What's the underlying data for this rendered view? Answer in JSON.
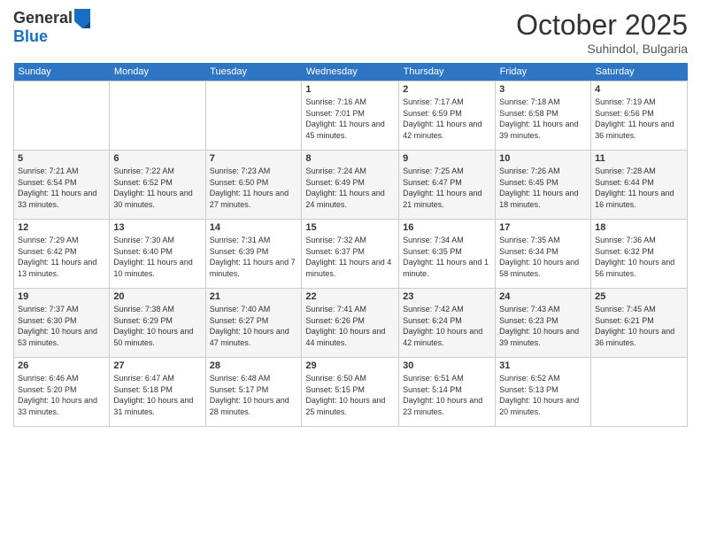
{
  "header": {
    "logo_general": "General",
    "logo_blue": "Blue",
    "month_title": "October 2025",
    "location": "Suhindol, Bulgaria"
  },
  "days_of_week": [
    "Sunday",
    "Monday",
    "Tuesday",
    "Wednesday",
    "Thursday",
    "Friday",
    "Saturday"
  ],
  "weeks": [
    [
      {
        "day": "",
        "sunrise": "",
        "sunset": "",
        "daylight": ""
      },
      {
        "day": "",
        "sunrise": "",
        "sunset": "",
        "daylight": ""
      },
      {
        "day": "",
        "sunrise": "",
        "sunset": "",
        "daylight": ""
      },
      {
        "day": "1",
        "sunrise": "Sunrise: 7:16 AM",
        "sunset": "Sunset: 7:01 PM",
        "daylight": "Daylight: 11 hours and 45 minutes."
      },
      {
        "day": "2",
        "sunrise": "Sunrise: 7:17 AM",
        "sunset": "Sunset: 6:59 PM",
        "daylight": "Daylight: 11 hours and 42 minutes."
      },
      {
        "day": "3",
        "sunrise": "Sunrise: 7:18 AM",
        "sunset": "Sunset: 6:58 PM",
        "daylight": "Daylight: 11 hours and 39 minutes."
      },
      {
        "day": "4",
        "sunrise": "Sunrise: 7:19 AM",
        "sunset": "Sunset: 6:56 PM",
        "daylight": "Daylight: 11 hours and 36 minutes."
      }
    ],
    [
      {
        "day": "5",
        "sunrise": "Sunrise: 7:21 AM",
        "sunset": "Sunset: 6:54 PM",
        "daylight": "Daylight: 11 hours and 33 minutes."
      },
      {
        "day": "6",
        "sunrise": "Sunrise: 7:22 AM",
        "sunset": "Sunset: 6:52 PM",
        "daylight": "Daylight: 11 hours and 30 minutes."
      },
      {
        "day": "7",
        "sunrise": "Sunrise: 7:23 AM",
        "sunset": "Sunset: 6:50 PM",
        "daylight": "Daylight: 11 hours and 27 minutes."
      },
      {
        "day": "8",
        "sunrise": "Sunrise: 7:24 AM",
        "sunset": "Sunset: 6:49 PM",
        "daylight": "Daylight: 11 hours and 24 minutes."
      },
      {
        "day": "9",
        "sunrise": "Sunrise: 7:25 AM",
        "sunset": "Sunset: 6:47 PM",
        "daylight": "Daylight: 11 hours and 21 minutes."
      },
      {
        "day": "10",
        "sunrise": "Sunrise: 7:26 AM",
        "sunset": "Sunset: 6:45 PM",
        "daylight": "Daylight: 11 hours and 18 minutes."
      },
      {
        "day": "11",
        "sunrise": "Sunrise: 7:28 AM",
        "sunset": "Sunset: 6:44 PM",
        "daylight": "Daylight: 11 hours and 16 minutes."
      }
    ],
    [
      {
        "day": "12",
        "sunrise": "Sunrise: 7:29 AM",
        "sunset": "Sunset: 6:42 PM",
        "daylight": "Daylight: 11 hours and 13 minutes."
      },
      {
        "day": "13",
        "sunrise": "Sunrise: 7:30 AM",
        "sunset": "Sunset: 6:40 PM",
        "daylight": "Daylight: 11 hours and 10 minutes."
      },
      {
        "day": "14",
        "sunrise": "Sunrise: 7:31 AM",
        "sunset": "Sunset: 6:39 PM",
        "daylight": "Daylight: 11 hours and 7 minutes."
      },
      {
        "day": "15",
        "sunrise": "Sunrise: 7:32 AM",
        "sunset": "Sunset: 6:37 PM",
        "daylight": "Daylight: 11 hours and 4 minutes."
      },
      {
        "day": "16",
        "sunrise": "Sunrise: 7:34 AM",
        "sunset": "Sunset: 6:35 PM",
        "daylight": "Daylight: 11 hours and 1 minute."
      },
      {
        "day": "17",
        "sunrise": "Sunrise: 7:35 AM",
        "sunset": "Sunset: 6:34 PM",
        "daylight": "Daylight: 10 hours and 58 minutes."
      },
      {
        "day": "18",
        "sunrise": "Sunrise: 7:36 AM",
        "sunset": "Sunset: 6:32 PM",
        "daylight": "Daylight: 10 hours and 56 minutes."
      }
    ],
    [
      {
        "day": "19",
        "sunrise": "Sunrise: 7:37 AM",
        "sunset": "Sunset: 6:30 PM",
        "daylight": "Daylight: 10 hours and 53 minutes."
      },
      {
        "day": "20",
        "sunrise": "Sunrise: 7:38 AM",
        "sunset": "Sunset: 6:29 PM",
        "daylight": "Daylight: 10 hours and 50 minutes."
      },
      {
        "day": "21",
        "sunrise": "Sunrise: 7:40 AM",
        "sunset": "Sunset: 6:27 PM",
        "daylight": "Daylight: 10 hours and 47 minutes."
      },
      {
        "day": "22",
        "sunrise": "Sunrise: 7:41 AM",
        "sunset": "Sunset: 6:26 PM",
        "daylight": "Daylight: 10 hours and 44 minutes."
      },
      {
        "day": "23",
        "sunrise": "Sunrise: 7:42 AM",
        "sunset": "Sunset: 6:24 PM",
        "daylight": "Daylight: 10 hours and 42 minutes."
      },
      {
        "day": "24",
        "sunrise": "Sunrise: 7:43 AM",
        "sunset": "Sunset: 6:23 PM",
        "daylight": "Daylight: 10 hours and 39 minutes."
      },
      {
        "day": "25",
        "sunrise": "Sunrise: 7:45 AM",
        "sunset": "Sunset: 6:21 PM",
        "daylight": "Daylight: 10 hours and 36 minutes."
      }
    ],
    [
      {
        "day": "26",
        "sunrise": "Sunrise: 6:46 AM",
        "sunset": "Sunset: 5:20 PM",
        "daylight": "Daylight: 10 hours and 33 minutes."
      },
      {
        "day": "27",
        "sunrise": "Sunrise: 6:47 AM",
        "sunset": "Sunset: 5:18 PM",
        "daylight": "Daylight: 10 hours and 31 minutes."
      },
      {
        "day": "28",
        "sunrise": "Sunrise: 6:48 AM",
        "sunset": "Sunset: 5:17 PM",
        "daylight": "Daylight: 10 hours and 28 minutes."
      },
      {
        "day": "29",
        "sunrise": "Sunrise: 6:50 AM",
        "sunset": "Sunset: 5:15 PM",
        "daylight": "Daylight: 10 hours and 25 minutes."
      },
      {
        "day": "30",
        "sunrise": "Sunrise: 6:51 AM",
        "sunset": "Sunset: 5:14 PM",
        "daylight": "Daylight: 10 hours and 23 minutes."
      },
      {
        "day": "31",
        "sunrise": "Sunrise: 6:52 AM",
        "sunset": "Sunset: 5:13 PM",
        "daylight": "Daylight: 10 hours and 20 minutes."
      },
      {
        "day": "",
        "sunrise": "",
        "sunset": "",
        "daylight": ""
      }
    ]
  ]
}
